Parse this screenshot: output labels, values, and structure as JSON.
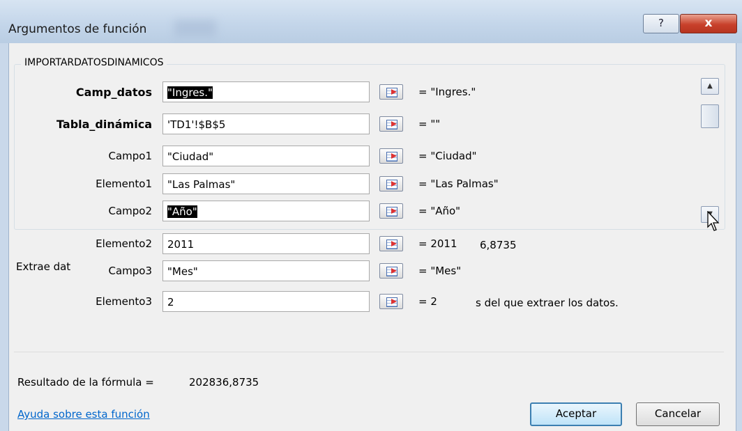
{
  "window": {
    "title": "Argumentos de función",
    "help_label": "?",
    "close_label": "x"
  },
  "group": {
    "label": "IMPORTARDATOSDINAMICOS"
  },
  "args": [
    {
      "label": "Camp_datos",
      "value": "\"Ingres.\"",
      "result": "= \"Ingres.\""
    },
    {
      "label": "Tabla_dinámica",
      "value": "'TD1'!$B$5",
      "result": "= \"\""
    },
    {
      "label": "Campo1",
      "value": "\"Ciudad\"",
      "result": "= \"Ciudad\""
    },
    {
      "label": "Elemento1",
      "value": "\"Las Palmas\"",
      "result": "= \"Las Palmas\""
    },
    {
      "label": "Campo2",
      "value": "\"Año\"",
      "result": "= \"Año\""
    },
    {
      "label": "Elemento2",
      "value": "2011",
      "result": "= 2011"
    },
    {
      "label": "Campo3",
      "value": "\"Mes\"",
      "result": "= \"Mes\""
    },
    {
      "label": "Elemento3",
      "value": "2",
      "result": "= 2"
    }
  ],
  "overlap": {
    "result_tail": "6,8735",
    "description_head": "Extrae dat",
    "description_tail": "s del que extraer los datos."
  },
  "footer": {
    "result_label": "Resultado de la fórmula =",
    "result_value": "202836,8735",
    "help_link": "Ayuda sobre esta función",
    "ok_label": "Aceptar",
    "cancel_label": "Cancelar"
  },
  "scrollbar": {
    "up_icon": "scroll-up-arrow",
    "down_icon": "scroll-down-arrow"
  }
}
